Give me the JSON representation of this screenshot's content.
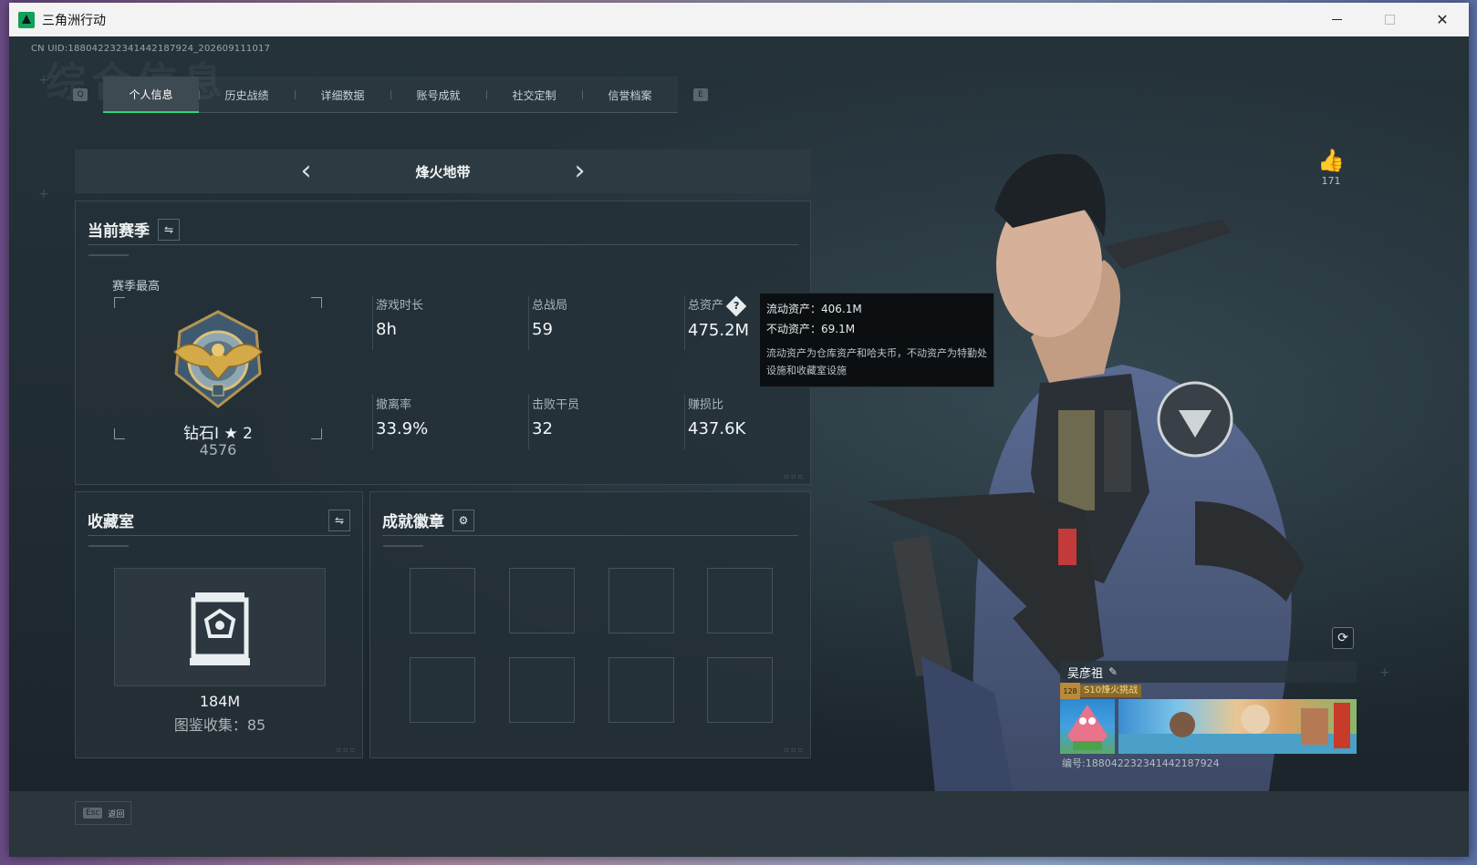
{
  "window": {
    "title": "三角洲行动"
  },
  "header": {
    "uid": "CN UID:18804223234144218792​4_202609111017",
    "ghost_title": "综合信息"
  },
  "tabs": {
    "left_key": "Q",
    "right_key": "E",
    "items": [
      {
        "label": "个人信息"
      },
      {
        "label": "历史战绩"
      },
      {
        "label": "详细数据"
      },
      {
        "label": "账号成就"
      },
      {
        "label": "社交定制"
      },
      {
        "label": "信誉档案"
      }
    ],
    "active_index": 0
  },
  "mode": {
    "title": "烽火地带"
  },
  "season": {
    "title": "当前赛季",
    "best_label": "赛季最高",
    "rank_name": "钻石Ⅰ ★ 2",
    "rank_score": "4576",
    "stats": [
      {
        "label": "游戏时长",
        "value": "8h"
      },
      {
        "label": "总战局",
        "value": "59"
      },
      {
        "label": "总资产",
        "value": "475.2M"
      },
      {
        "label": "撤离率",
        "value": "33.9%"
      },
      {
        "label": "击败干员",
        "value": "32"
      },
      {
        "label": "赚损比",
        "value": "437.6K"
      }
    ]
  },
  "tooltip": {
    "liquid": "流动资产：406.1M",
    "fixed": "不动资产：69.1M",
    "desc": "流动资产为仓库资产和哈夫币，不动资产为特勤处设施和收藏室设施"
  },
  "collection": {
    "title": "收藏室",
    "value": "184M",
    "count": "图鉴收集：85"
  },
  "achievements": {
    "title": "成就徽章"
  },
  "profile": {
    "likes": "171",
    "name": "吴彦祖",
    "level": "128",
    "season_tag": "S10烽火挑战",
    "uid": "编号:18804223234144218792​4"
  },
  "footer": {
    "esc_key": "Esc",
    "esc_label": "返回"
  },
  "colors": {
    "accent_green": "#2fd27a",
    "tooltip_bg": "#0b0f12"
  }
}
